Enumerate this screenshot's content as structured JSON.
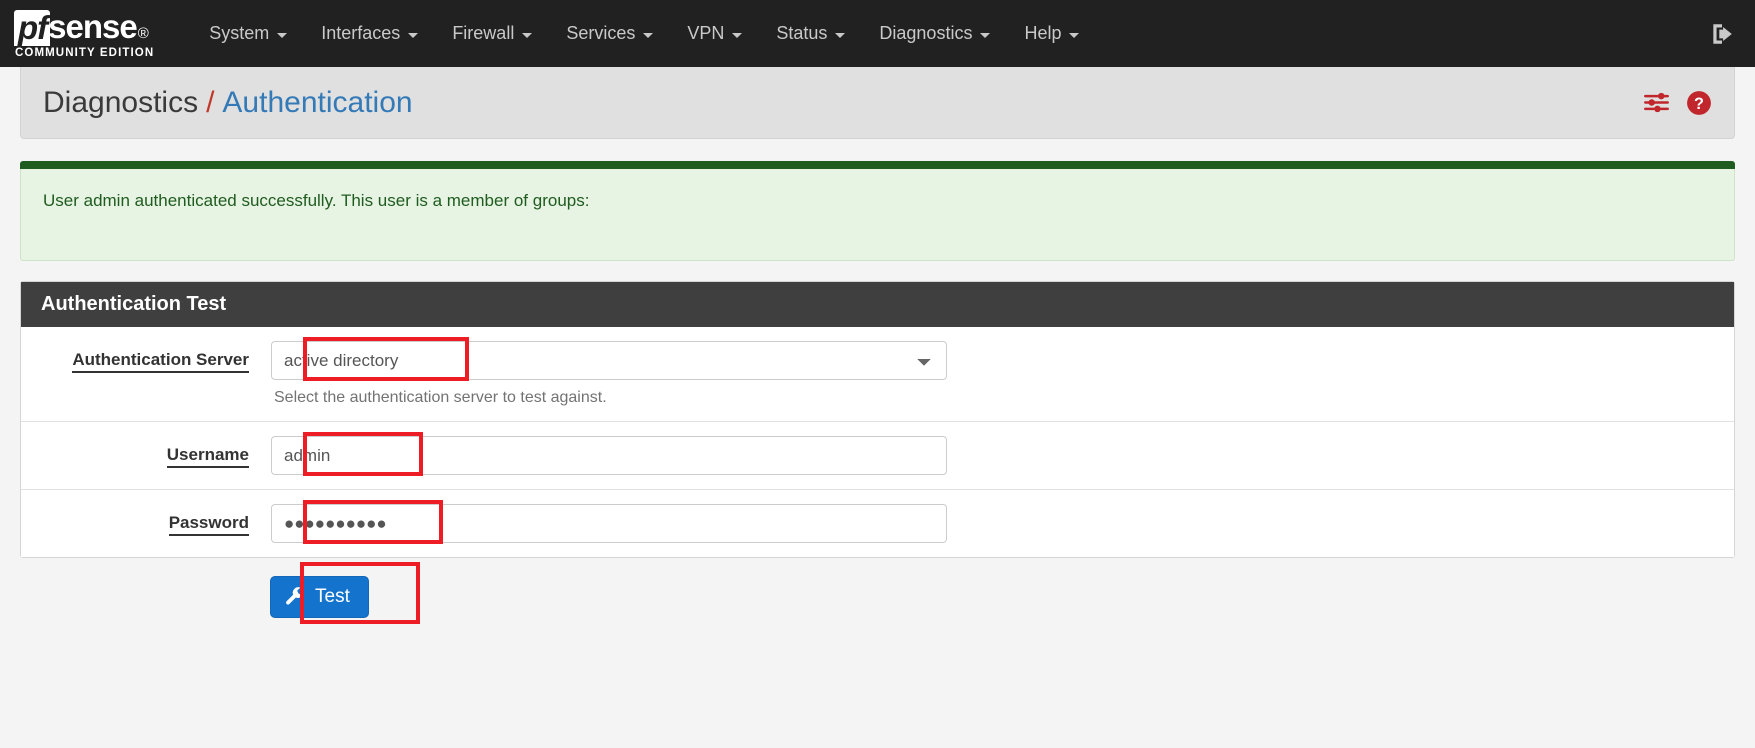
{
  "navbar": {
    "brand": {
      "pf": "pf",
      "sense": "sense",
      "registered": "®",
      "subtitle": "COMMUNITY EDITION"
    },
    "items": [
      {
        "label": "System",
        "name": "nav-item-system"
      },
      {
        "label": "Interfaces",
        "name": "nav-item-interfaces"
      },
      {
        "label": "Firewall",
        "name": "nav-item-firewall"
      },
      {
        "label": "Services",
        "name": "nav-item-services"
      },
      {
        "label": "VPN",
        "name": "nav-item-vpn"
      },
      {
        "label": "Status",
        "name": "nav-item-status"
      },
      {
        "label": "Diagnostics",
        "name": "nav-item-diagnostics"
      },
      {
        "label": "Help",
        "name": "nav-item-help"
      }
    ],
    "logout_icon": "logout-icon"
  },
  "breadcrumb": {
    "parent": "Diagnostics",
    "separator": "/",
    "current": "Authentication",
    "separator_color": "#c0392b",
    "current_color": "#337ab7",
    "icons": [
      {
        "name": "sliders-icon",
        "color": "#c0262b"
      },
      {
        "name": "help-circle-icon",
        "color": "#c0262b"
      }
    ]
  },
  "alert": {
    "message": "User admin authenticated successfully. This user is a member of groups:",
    "bar_color": "#1f5c1f",
    "background_color": "#e7f3e3",
    "text_color": "#1f5c1f"
  },
  "panel": {
    "title": "Authentication Test",
    "fields": [
      {
        "label": "Authentication Server",
        "type": "select",
        "value": "active directory",
        "help": "Select the authentication server to test against."
      },
      {
        "label": "Username",
        "type": "text",
        "value": "admin",
        "placeholder": "",
        "help": ""
      },
      {
        "label": "Password",
        "type": "password",
        "value": "●●●●●●●●●●",
        "placeholder": "",
        "help": ""
      }
    ],
    "submit": {
      "label": "Test",
      "icon": "wrench-icon",
      "color": "#1473cc"
    }
  }
}
